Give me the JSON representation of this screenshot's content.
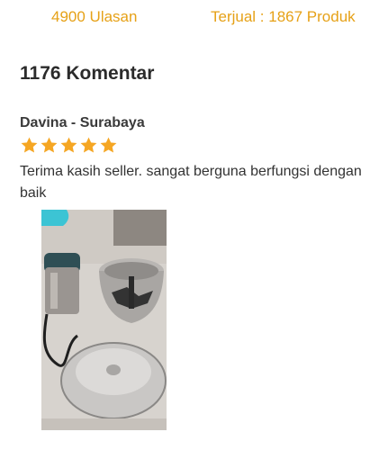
{
  "stats": {
    "reviews_label": "4900 Ulasan",
    "sold_label": "Terjual : 1867 Produk"
  },
  "comments": {
    "heading": "1176 Komentar"
  },
  "review": {
    "reviewer": "Davina - Surabaya",
    "rating": 5,
    "rating_max": 5,
    "text": " Terima kasih seller. sangat berguna berfungsi dengan baik"
  },
  "colors": {
    "accent": "#e6a117",
    "star": "#f5a623",
    "text": "#2b2b2b"
  },
  "icons": {
    "star": "star-icon"
  }
}
